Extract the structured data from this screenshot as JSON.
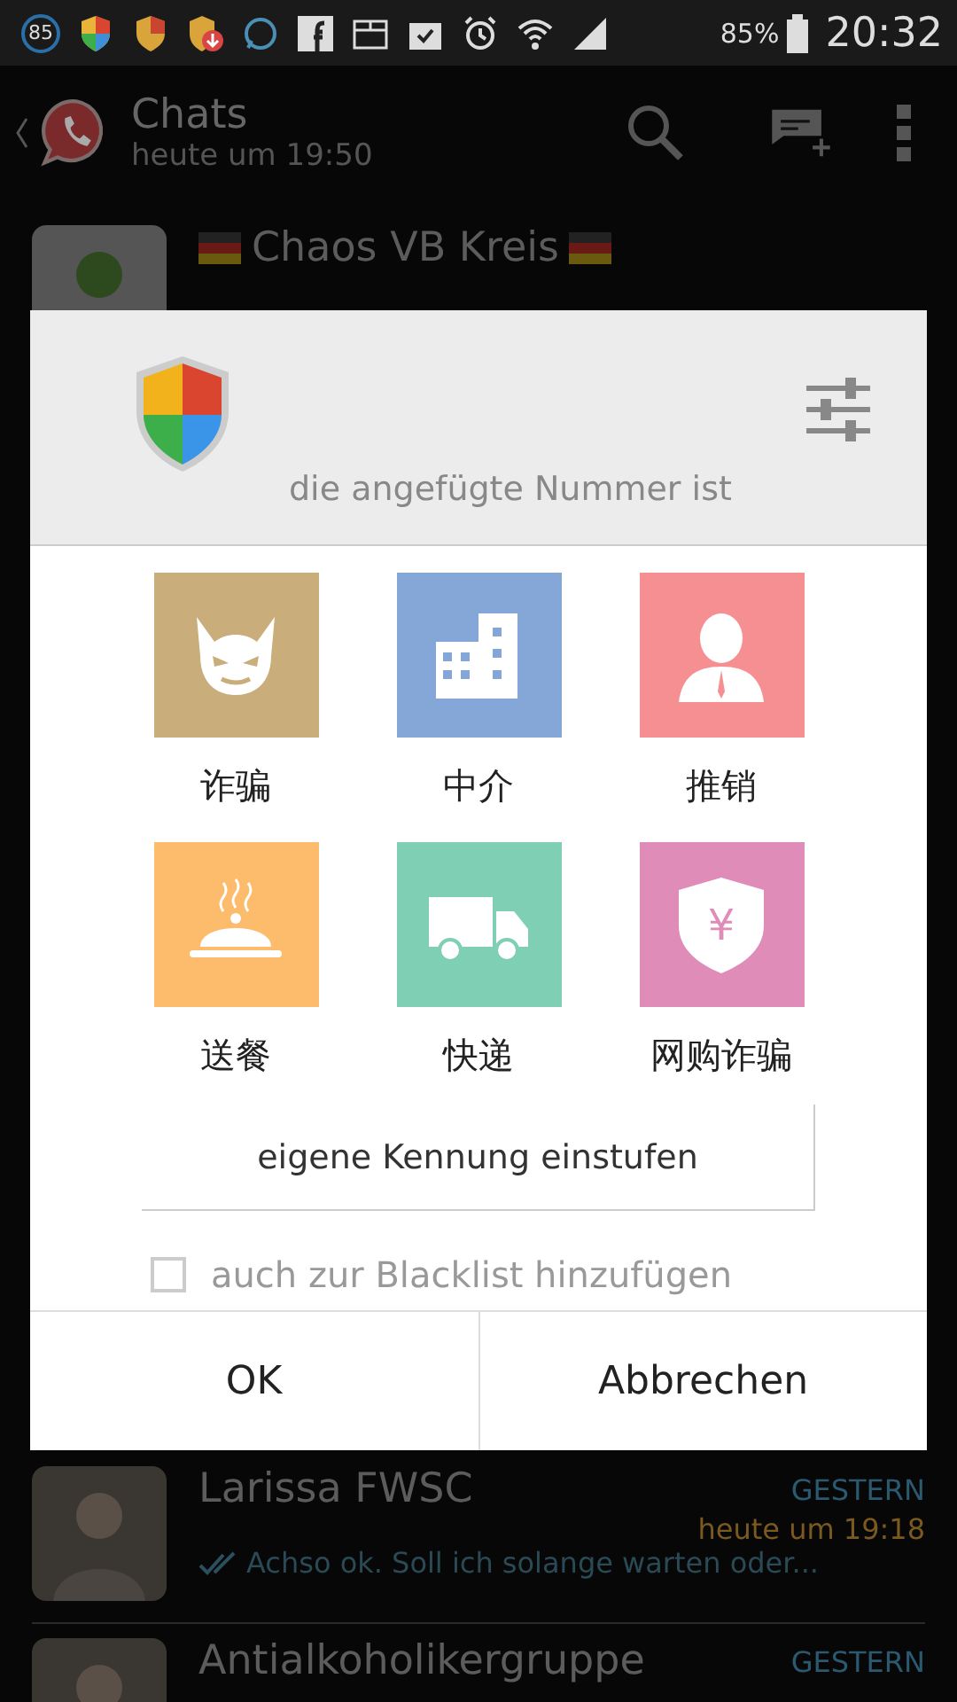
{
  "status_bar": {
    "badge": "85",
    "battery": "85%",
    "time": "20:32"
  },
  "action_bar": {
    "title": "Chats",
    "subtitle": "heute um 19:50"
  },
  "chats": [
    {
      "name": "Chaos VB Kreis",
      "kind": "group-flags"
    },
    {
      "name": "Larissa FWSC",
      "day": "GESTERN",
      "time": "heute um 19:18",
      "preview": "Achso ok. Soll ich solange warten oder...",
      "read": true,
      "kind": "plain"
    },
    {
      "name": "Antialkoholikergruppe",
      "day": "GESTERN",
      "kind": "plain"
    }
  ],
  "dialog": {
    "subtitle": "die angefügte Nummer ist",
    "categories": [
      {
        "label": "诈骗",
        "color": "#c9ad7a",
        "kind": "devil"
      },
      {
        "label": "中介",
        "color": "#85a7d8",
        "kind": "building"
      },
      {
        "label": "推销",
        "color": "#f58f92",
        "kind": "person"
      },
      {
        "label": "送餐",
        "color": "#fdbb6c",
        "kind": "food"
      },
      {
        "label": "快递",
        "color": "#7fcfb4",
        "kind": "truck"
      },
      {
        "label": "网购诈骗",
        "color": "#e08cb8",
        "kind": "shield",
        "glyph": "¥"
      }
    ],
    "custom_button": "eigene Kennung einstufen",
    "blacklist": {
      "label": "auch zur Blacklist hinzufügen",
      "checked": false
    },
    "buttons": [
      "OK",
      "Abbrechen"
    ]
  }
}
